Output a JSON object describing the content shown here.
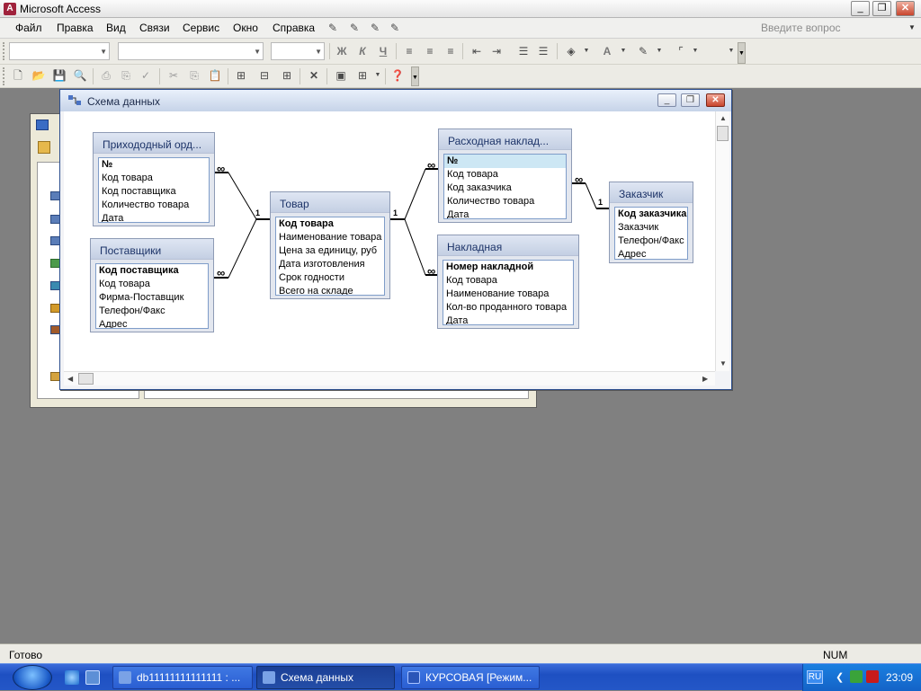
{
  "app": {
    "title": "Microsoft Access",
    "icon": "access-icon"
  },
  "menu": {
    "items": [
      "Файл",
      "Правка",
      "Вид",
      "Связи",
      "Сервис",
      "Окно",
      "Справка"
    ],
    "ask_placeholder": "Введите вопрос"
  },
  "toolbar1": {
    "labels": {
      "bold": "Ж",
      "italic": "К",
      "underline": "Ч",
      "font_color": "А"
    }
  },
  "relationships_window": {
    "title": "Схема данных",
    "tables": [
      {
        "id": "prikhodny",
        "title": "Прихододный орд...",
        "fields": [
          {
            "text": "№",
            "pk": true
          },
          {
            "text": "Код товара"
          },
          {
            "text": "Код поставщика"
          },
          {
            "text": "Количество товара"
          },
          {
            "text": "Дата"
          }
        ]
      },
      {
        "id": "postavshchiki",
        "title": "Поставщики",
        "fields": [
          {
            "text": "Код поставщика",
            "pk": true
          },
          {
            "text": "Код товара"
          },
          {
            "text": "Фирма-Поставщик"
          },
          {
            "text": "Телефон/Факс"
          },
          {
            "text": "Адрес"
          }
        ]
      },
      {
        "id": "tovar",
        "title": "Товар",
        "fields": [
          {
            "text": "Код товара",
            "pk": true
          },
          {
            "text": "Наименование товара"
          },
          {
            "text": "Цена за единицу, руб"
          },
          {
            "text": "Дата изготовления"
          },
          {
            "text": "Срок годности"
          },
          {
            "text": "Всего на складе"
          }
        ]
      },
      {
        "id": "raskhodnaya",
        "title": "Расходная наклад...",
        "fields": [
          {
            "text": "№",
            "pk": true,
            "selected": true
          },
          {
            "text": "Код товара"
          },
          {
            "text": "Код заказчика"
          },
          {
            "text": "Количество товара"
          },
          {
            "text": "Дата"
          }
        ]
      },
      {
        "id": "nakladnaya",
        "title": "Накладная",
        "fields": [
          {
            "text": "Номер накладной",
            "pk": true
          },
          {
            "text": "Код товара"
          },
          {
            "text": "Наименование товара"
          },
          {
            "text": "Кол-во проданного товара"
          },
          {
            "text": "Дата"
          }
        ]
      },
      {
        "id": "zakazchik",
        "title": "Заказчик",
        "fields": [
          {
            "text": "Код заказчика",
            "pk": true
          },
          {
            "text": "Заказчик"
          },
          {
            "text": "Телефон/Факс"
          },
          {
            "text": "Адрес"
          }
        ]
      }
    ],
    "relationships": [
      {
        "from": "prikhodny",
        "to": "tovar",
        "from_label": "∞",
        "to_label": "1"
      },
      {
        "from": "postavshchiki",
        "to": "tovar",
        "from_label": "∞",
        "to_label": "1"
      },
      {
        "from": "tovar",
        "to": "raskhodnaya",
        "from_label": "1",
        "to_label": "∞"
      },
      {
        "from": "tovar",
        "to": "nakladnaya",
        "from_label": "1",
        "to_label": "∞"
      },
      {
        "from": "raskhodnaya",
        "to": "zakazchik",
        "from_label": "∞",
        "to_label": "1"
      }
    ]
  },
  "status": {
    "text": "Готово",
    "num": "NUM"
  },
  "taskbar": {
    "tasks": [
      {
        "label": "db11111111111111 : ...",
        "icon": "database-icon"
      },
      {
        "label": "Схема данных",
        "icon": "relationships-icon",
        "active": true
      },
      {
        "label": "КУРСОВАЯ [Режим...",
        "icon": "word-icon"
      }
    ],
    "lang": "RU",
    "clock": "23:09"
  }
}
